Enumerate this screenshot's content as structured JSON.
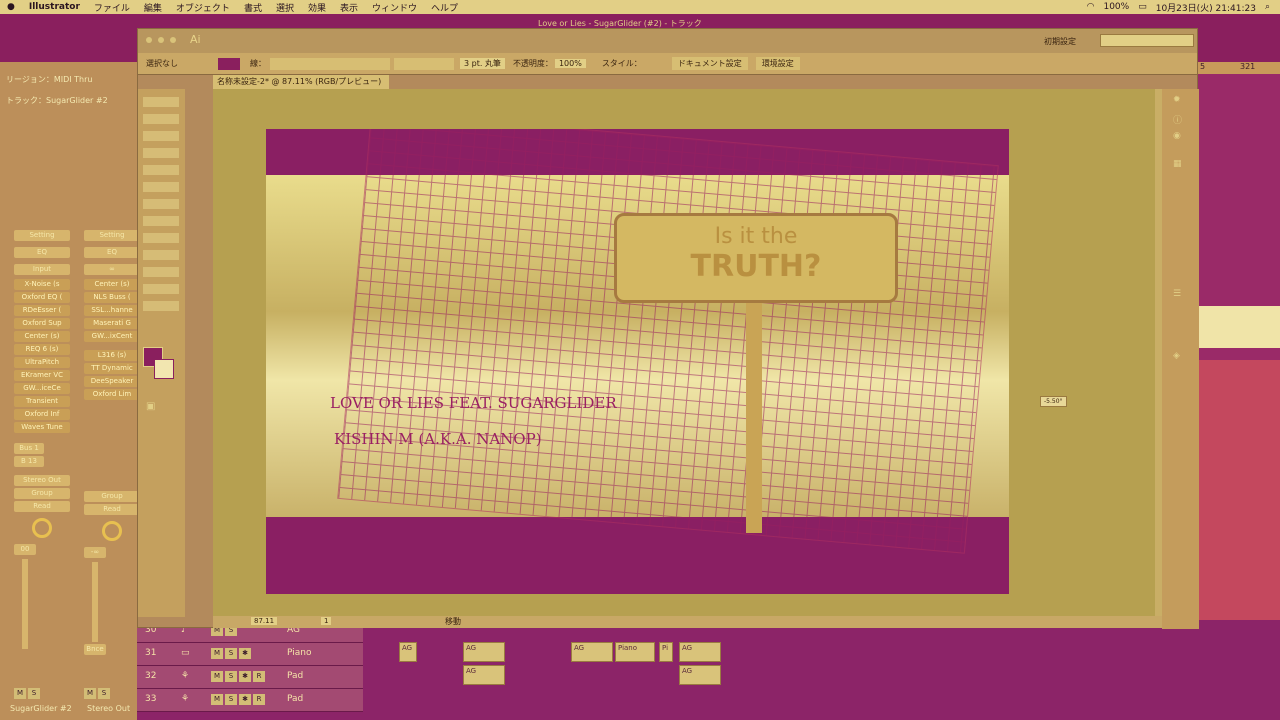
{
  "menubar": {
    "app": "Illustrator",
    "items": [
      "ファイル",
      "編集",
      "オブジェクト",
      "書式",
      "選択",
      "効果",
      "表示",
      "ウィンドウ",
      "ヘルプ"
    ],
    "battery": "100%",
    "clock": "10月23日(火) 21:41:23"
  },
  "window": {
    "title": "Love or Lies - SugarGlider (#2) - トラック",
    "ai_logo": "Ai",
    "workspace": "初期設定"
  },
  "controlbar": {
    "selection": "選択なし",
    "stroke_label": "線：",
    "brush": "3 pt. 丸筆",
    "opacity_label": "不透明度：",
    "opacity_value": "100%",
    "style_label": "スタイル：",
    "doc_setup": "ドキュメント設定",
    "prefs": "環境設定"
  },
  "document_tab": "名称未設定-2* @ 87.11% (RGB/プレビュー)",
  "status": {
    "zoom": "87.11",
    "page": "1",
    "tool": "移動"
  },
  "artwork": {
    "sign_line1": "Is it the",
    "sign_line2": "TRUTH?",
    "text1": "LOVE OR LIES FEAT. SUGARGLIDER",
    "text2": "KISHIN M (A.K.A. NANOP)",
    "angle": "-5.50°"
  },
  "daw_left": {
    "region": "リージョン：MIDI Thru",
    "track": "トラック：SugarGlider #2",
    "ruler": [
      "5",
      "321"
    ],
    "strip1": {
      "setting": "Setting",
      "eq": "EQ",
      "input": "Input",
      "plugins": [
        "X-Noise (s",
        "Oxford EQ (",
        "RDeEsser (",
        "Oxford Sup",
        "Center (s)",
        "REQ 6 (s)",
        "UltraPitch",
        "EKramer VC",
        "GW...iceCe",
        "Transient",
        "Oxford Inf",
        "Waves Tune"
      ],
      "sends": [
        "Bus 1",
        "B 13"
      ],
      "out": "Stereo Out",
      "group": "Group",
      "read": "Read",
      "value": "00",
      "name": "SugarGlider #2"
    },
    "strip2": {
      "setting": "Setting",
      "eq": "EQ",
      "plugins": [
        "Center (s)",
        "NLS Buss (",
        "SSL...hanne",
        "Maserati G",
        "GW...ixCent",
        "L316 (s)",
        "TT Dynamic",
        "DeeSpeaker",
        "Oxford Lim"
      ],
      "group": "Group",
      "read": "Read",
      "value": "-∞",
      "bnce": "Bnce",
      "name": "Stereo Out"
    }
  },
  "tracks": [
    {
      "num": "30",
      "name": "AG"
    },
    {
      "num": "31",
      "name": "Piano"
    },
    {
      "num": "32",
      "name": "Pad"
    },
    {
      "num": "33",
      "name": "Pad"
    }
  ],
  "track_buttons": {
    "m": "M",
    "s": "S",
    "r": "R"
  },
  "regions": [
    "AG",
    "AG",
    "AG",
    "AG",
    "Piano",
    "Pi",
    "AG",
    "AG"
  ],
  "colors": {
    "accent": "#8a1f5e",
    "yellow": "#e2cf86"
  }
}
